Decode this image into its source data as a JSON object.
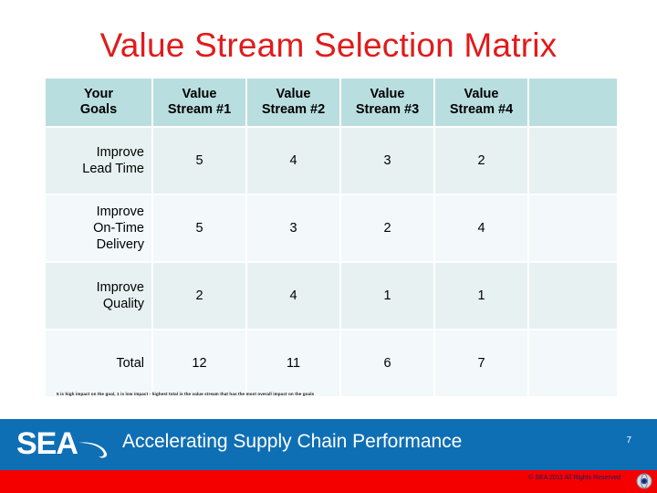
{
  "slide": {
    "title": "Value Stream Selection Matrix",
    "title_color": "#e01b1b",
    "number": "7"
  },
  "matrix": {
    "headers": [
      "Your\nGoals",
      "Value\nStream #1",
      "Value\nStream #2",
      "Value\nStream #3",
      "Value\nStream #4",
      ""
    ],
    "header_line1": [
      "Your",
      "Value",
      "Value",
      "Value",
      "Value",
      ""
    ],
    "header_line2": [
      "Goals",
      "Stream #1",
      "Stream #2",
      "Stream #3",
      "Stream #4",
      ""
    ],
    "rows": [
      {
        "goal_lines": [
          "Improve",
          "Lead Time"
        ],
        "scores": [
          "5",
          "4",
          "3",
          "2"
        ],
        "blank": ""
      },
      {
        "goal_lines": [
          "Improve",
          "On-Time",
          "Delivery"
        ],
        "scores": [
          "5",
          "3",
          "2",
          "4"
        ],
        "blank": ""
      },
      {
        "goal_lines": [
          "Improve",
          "Quality"
        ],
        "scores": [
          "2",
          "4",
          "1",
          "1"
        ],
        "blank": ""
      },
      {
        "goal_lines": [
          "Total"
        ],
        "scores": [
          "12",
          "11",
          "6",
          "7"
        ],
        "blank": ""
      }
    ],
    "header_bg": "#b9dee0",
    "row_odd_bg": "#e8f1f1",
    "row_even_bg": "#f3f8fa"
  },
  "footnote": "5 is high impact on the goal, 1 is low impact - highest total is the value stream that has the most overall impact on the goals",
  "footer": {
    "logo_text": "SEA",
    "tagline": "Accelerating Supply Chain Performance",
    "copyright": "© SEA 2011 All Rights Reserved",
    "blue_color": "#0f6fb5",
    "red_color": "#f50000"
  }
}
